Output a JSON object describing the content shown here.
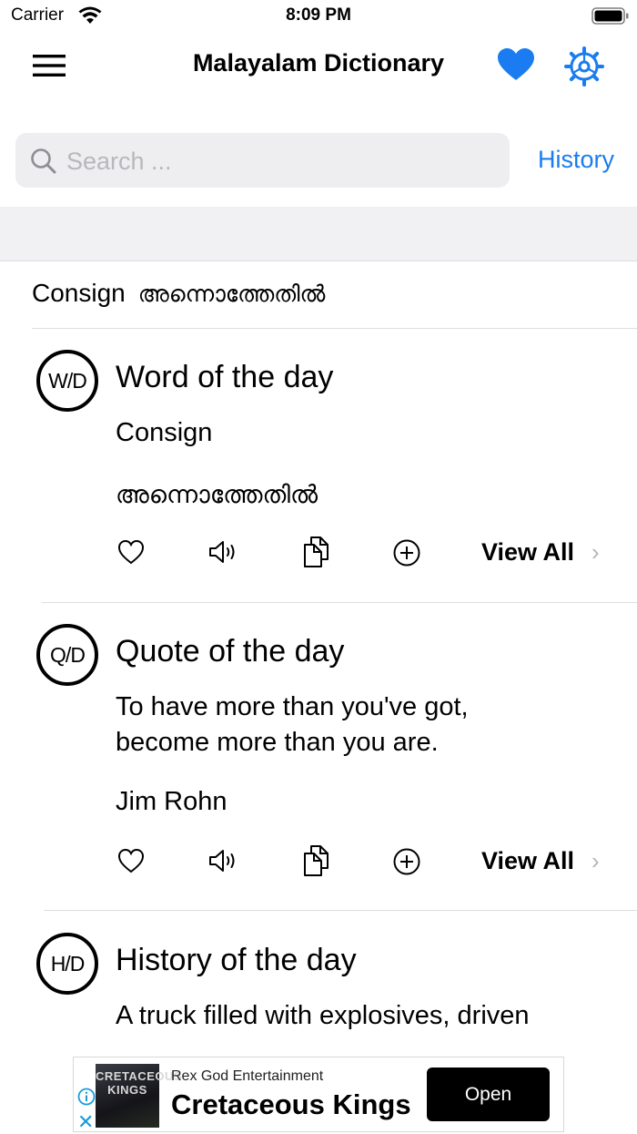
{
  "status_bar": {
    "carrier": "Carrier",
    "time": "8:09 PM"
  },
  "nav": {
    "title": "Malayalam Dictionary",
    "menu_icon": "hamburger-menu-icon",
    "favorites_icon": "heart-icon",
    "settings_icon": "gear-icon",
    "accent_color": "#1a7cf0"
  },
  "search": {
    "placeholder": "Search ...",
    "value": "",
    "history_label": "History"
  },
  "recent": {
    "english": "Consign",
    "malayalam": "അന്നൊത്തേതിൽ"
  },
  "cards": [
    {
      "badge": "W/D",
      "title": "Word of the day",
      "line1": "Consign",
      "line2": "അന്നൊത്തേതിൽ",
      "view_all": "View All"
    },
    {
      "badge": "Q/D",
      "title": "Quote of the day",
      "line1": "To have more than you've got, become more than you are.",
      "line2": "Jim Rohn",
      "view_all": "View All"
    },
    {
      "badge": "H/D",
      "title": "History of the day",
      "line1": "A truck filled with explosives, driven"
    }
  ],
  "ad": {
    "image_text": "CRETACEOUS KINGS",
    "advertiser": "Rex God Entertainment",
    "title": "Cretaceous Kings",
    "button": "Open"
  }
}
